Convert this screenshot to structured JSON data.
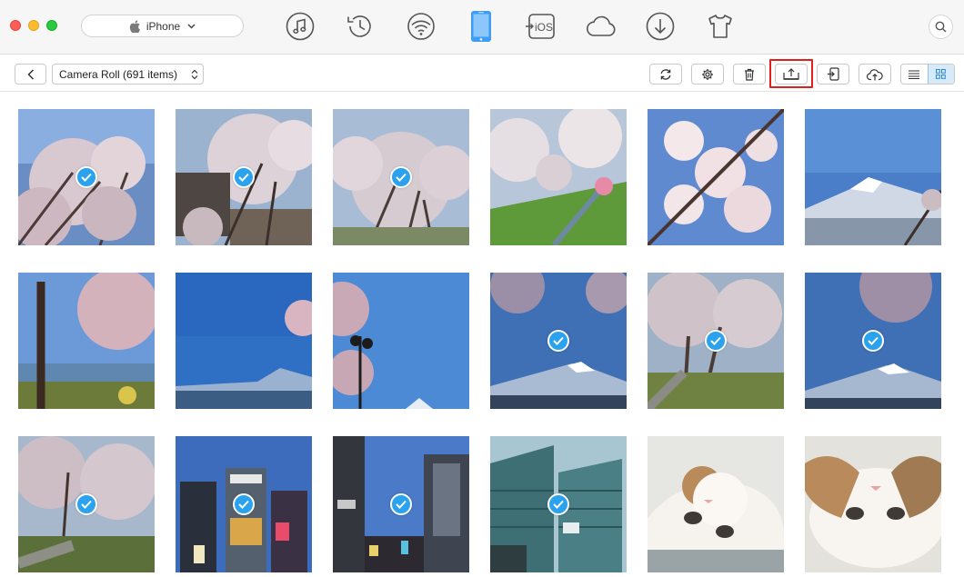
{
  "window": {
    "controls": [
      "close",
      "minimize",
      "zoom"
    ]
  },
  "device_selector": {
    "icon": "apple-icon",
    "value": "iPhone"
  },
  "nav_icons": [
    {
      "name": "music-icon"
    },
    {
      "name": "history-icon"
    },
    {
      "name": "wifi-icon"
    },
    {
      "name": "iphone-icon",
      "active": true
    },
    {
      "name": "to-ios-icon",
      "label": "iOS"
    },
    {
      "name": "icloud-icon"
    },
    {
      "name": "download-icon"
    },
    {
      "name": "tshirt-icon"
    }
  ],
  "search": {
    "icon": "search-icon"
  },
  "toolbar": {
    "album": "Camera Roll (691 items)",
    "buttons": [
      "refresh-icon",
      "settings-icon",
      "trash-icon",
      "export-to-computer-icon",
      "add-to-device-icon",
      "cloud-upload-icon"
    ],
    "highlighted_button": "export-to-computer-icon",
    "views": [
      "list-view-icon",
      "grid-view-icon"
    ],
    "active_view": "grid-view-icon"
  },
  "colors": {
    "accent": "#2aa2ee",
    "highlight": "#e0211a",
    "active_nav": "#3d9df5"
  },
  "photos": [
    {
      "subject": "cherry-blossom",
      "selected": true
    },
    {
      "subject": "cherry-blossom-house",
      "selected": true
    },
    {
      "subject": "cherry-blossom",
      "selected": true
    },
    {
      "subject": "cherry-blossom-canal",
      "selected": false
    },
    {
      "subject": "cherry-blossom-closeup",
      "selected": false
    },
    {
      "subject": "mount-fuji",
      "selected": false
    },
    {
      "subject": "lake-fuji-tree",
      "selected": false
    },
    {
      "subject": "fuji-blue-sky",
      "selected": false
    },
    {
      "subject": "street-lamp-blossom",
      "selected": false
    },
    {
      "subject": "fuji-blossom",
      "selected": true
    },
    {
      "subject": "blossom-path",
      "selected": true
    },
    {
      "subject": "fuji-blossom",
      "selected": true
    },
    {
      "subject": "blossom-river-path",
      "selected": true
    },
    {
      "subject": "city-ricoh",
      "selected": true
    },
    {
      "subject": "city-street",
      "selected": true
    },
    {
      "subject": "city-buildings-piaget",
      "selected": true
    },
    {
      "subject": "kitten",
      "selected": false
    },
    {
      "subject": "kitten",
      "selected": false
    }
  ]
}
